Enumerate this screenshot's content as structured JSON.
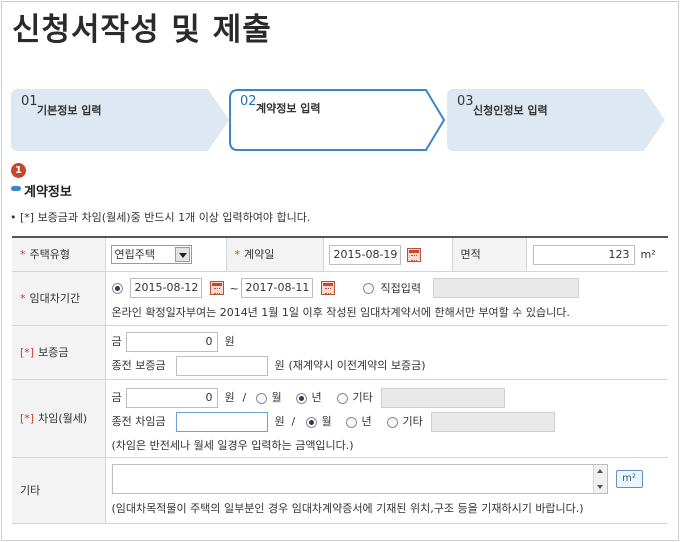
{
  "page_title": "신청서작성 및 제출",
  "steps": [
    {
      "num": "01",
      "label": "기본정보 입력",
      "active": false
    },
    {
      "num": "02",
      "label": "계약정보 입력",
      "active": true
    },
    {
      "num": "03",
      "label": "신청인정보 입력",
      "active": false
    }
  ],
  "badge": "1",
  "section_title": "계약정보",
  "notice": "•  [*] 보증금과 차임(월세)중 반드시 1개 이상 입력하여야 합니다.",
  "form": {
    "housing_type": {
      "label": "주택유형",
      "required_mark": "*",
      "value": "연립주택"
    },
    "contract_date": {
      "label": "계약일",
      "required_mark": "*",
      "value": "2015-08-19"
    },
    "area": {
      "label": "면적",
      "value": "123",
      "unit": "m²"
    },
    "lease_period": {
      "label": "임대차기간",
      "required_mark": "*",
      "start": "2015-08-12",
      "tilde": "~",
      "end": "2017-08-11",
      "direct_input_label": "직접입력",
      "note": "온라인 확정일자부여는 2014년 1월 1일 이후 작성된 임대차계약서에 한해서만 부여할 수 있습니다."
    },
    "deposit": {
      "label": "보증금",
      "mark": "[*]",
      "amount_label": "금",
      "amount": "0",
      "currency": "원",
      "prev_label": "종전 보증금",
      "prev_currency": "원",
      "prev_note": "(재계약시 이전계약의 보증금)"
    },
    "rent": {
      "label": "차임(월세)",
      "mark": "[*]",
      "amount_label": "금",
      "amount": "0",
      "currency": "원",
      "slash": "/",
      "period_options": [
        "월",
        "년",
        "기타"
      ],
      "period_selected": "년",
      "prev_label": "종전 차임금",
      "prev_currency": "원",
      "prev_slash": "/",
      "prev_period_options": [
        "월",
        "년",
        "기타"
      ],
      "prev_period_selected": "월",
      "note": "(차임은 반전세나 월세 일경우 입력하는 금액입니다.)"
    },
    "etc": {
      "label": "기타",
      "unit_button": "m²",
      "note": "(임대차목적물이 주택의 일부분인 경우 임대차계약증서에 기재된 위치,구조 등을 기재하시기 바랍니다.)"
    }
  },
  "colors": {
    "accent": "#3a86c9",
    "required": "#c7462d",
    "step_inactive": "#dde8f3",
    "step_active_border": "#3a86c9"
  }
}
